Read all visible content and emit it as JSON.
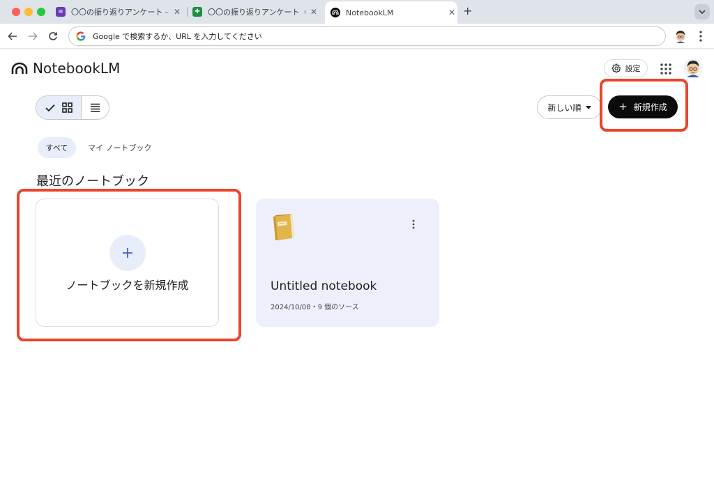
{
  "browser": {
    "tabs": [
      {
        "title": "〇〇の振り返りアンケート - Goo",
        "favicon": "google-forms-icon",
        "color": "#673ab7"
      },
      {
        "title": "〇〇の振り返りアンケート（回答",
        "favicon": "google-sheets-icon",
        "color": "#1e8e3e"
      },
      {
        "title": "NotebookLM",
        "favicon": "notebooklm-icon",
        "active": true
      }
    ],
    "address_placeholder": "Google で検索するか、URL を入力してください"
  },
  "header": {
    "logo_text": "NotebookLM",
    "settings_label": "設定"
  },
  "toolbar": {
    "sort_label": "新しい順",
    "create_label": "新規作成"
  },
  "filters": {
    "all_label": "すべて",
    "mine_label": "マイ ノートブック"
  },
  "main": {
    "section_title": "最近のノートブック",
    "new_card": {
      "plus": "+",
      "label": "ノートブックを新規作成"
    },
    "notebooks": [
      {
        "title": "Untitled notebook",
        "meta": "2024/10/08・9 個のソース",
        "icon": "notebook-emoji-icon"
      }
    ]
  },
  "colors": {
    "accent_bg": "#e8edfa",
    "create_button": "#0b0b0b",
    "highlight": "#e8452c"
  }
}
